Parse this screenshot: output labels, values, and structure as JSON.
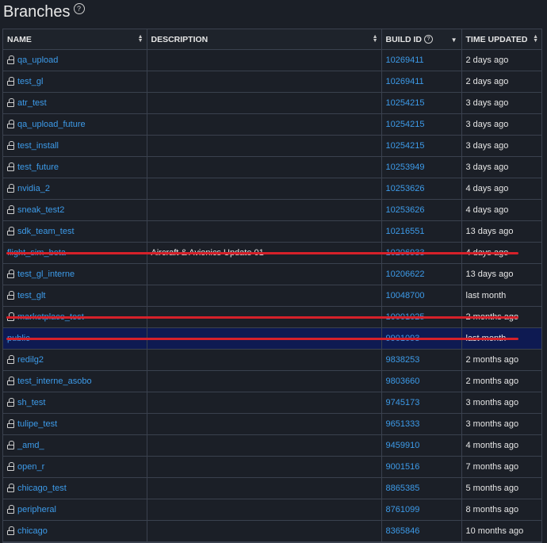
{
  "page": {
    "title": "Branches",
    "help_icon": "?"
  },
  "columns": {
    "name": "NAME",
    "description": "DESCRIPTION",
    "build_id": "BUILD ID",
    "build_id_help": "?",
    "time_updated": "TIME UPDATED"
  },
  "rows": [
    {
      "name": "qa_upload",
      "description": "",
      "build_id": "10269411",
      "time": "2 days ago",
      "locked": true
    },
    {
      "name": "test_gl",
      "description": "",
      "build_id": "10269411",
      "time": "2 days ago",
      "locked": true
    },
    {
      "name": "atr_test",
      "description": "",
      "build_id": "10254215",
      "time": "3 days ago",
      "locked": true
    },
    {
      "name": "qa_upload_future",
      "description": "",
      "build_id": "10254215",
      "time": "3 days ago",
      "locked": true
    },
    {
      "name": "test_install",
      "description": "",
      "build_id": "10254215",
      "time": "3 days ago",
      "locked": true
    },
    {
      "name": "test_future",
      "description": "",
      "build_id": "10253949",
      "time": "3 days ago",
      "locked": true
    },
    {
      "name": "nvidia_2",
      "description": "",
      "build_id": "10253626",
      "time": "4 days ago",
      "locked": true
    },
    {
      "name": "sneak_test2",
      "description": "",
      "build_id": "10253626",
      "time": "4 days ago",
      "locked": true
    },
    {
      "name": "sdk_team_test",
      "description": "",
      "build_id": "10216551",
      "time": "13 days ago",
      "locked": true
    },
    {
      "name": "flight_sim_beta",
      "description": "Aircraft & Avionics Update 01",
      "build_id": "10206933",
      "time": "4 days ago",
      "locked": false,
      "struck": true
    },
    {
      "name": "test_gl_interne",
      "description": "",
      "build_id": "10206622",
      "time": "13 days ago",
      "locked": true
    },
    {
      "name": "test_glt",
      "description": "",
      "build_id": "10048700",
      "time": "last month",
      "locked": true
    },
    {
      "name": "marketplace_test",
      "description": "",
      "build_id": "10001025",
      "time": "2 months ago",
      "locked": true,
      "struck": true
    },
    {
      "name": "public",
      "description": "",
      "build_id": "9901093",
      "time": "last month",
      "locked": false,
      "struck": true,
      "highlight": true
    },
    {
      "name": "redilg2",
      "description": "",
      "build_id": "9838253",
      "time": "2 months ago",
      "locked": true
    },
    {
      "name": "test_interne_asobo",
      "description": "",
      "build_id": "9803660",
      "time": "2 months ago",
      "locked": true
    },
    {
      "name": "sh_test",
      "description": "",
      "build_id": "9745173",
      "time": "3 months ago",
      "locked": true
    },
    {
      "name": "tulipe_test",
      "description": "",
      "build_id": "9651333",
      "time": "3 months ago",
      "locked": true
    },
    {
      "name": "_amd_",
      "description": "",
      "build_id": "9459910",
      "time": "4 months ago",
      "locked": true
    },
    {
      "name": "open_r",
      "description": "",
      "build_id": "9001516",
      "time": "7 months ago",
      "locked": true
    },
    {
      "name": "chicago_test",
      "description": "",
      "build_id": "8865385",
      "time": "5 months ago",
      "locked": true
    },
    {
      "name": "peripheral",
      "description": "",
      "build_id": "8761099",
      "time": "8 months ago",
      "locked": true
    },
    {
      "name": "chicago",
      "description": "",
      "build_id": "8365846",
      "time": "10 months ago",
      "locked": true
    }
  ]
}
